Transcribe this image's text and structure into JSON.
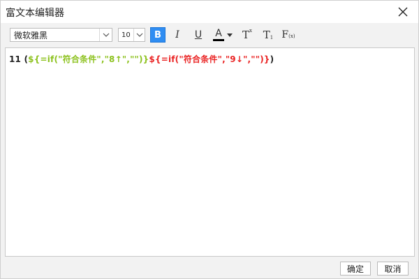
{
  "window": {
    "title": "富文本编辑器"
  },
  "toolbar": {
    "font_family": "微软雅黑",
    "font_size": "10",
    "bold_label": "B",
    "italic_label": "I",
    "underline_label": "U",
    "color_label": "A",
    "superscript_label": "T",
    "superscript_small": "x",
    "subscript_label": "T",
    "subscript_small": "1",
    "formula_label": "F",
    "formula_small": "(x)",
    "active_color": "#000000",
    "bold_active": true
  },
  "editor": {
    "prefix": "11  (",
    "green_segment": "${=if(\"符合条件\",\"8↑\",\"\")}",
    "red_segment": "${=if(\"符合条件\",\"9↓\",\"\")}",
    "suffix": ")",
    "colors": {
      "green": "#8dc21f",
      "red": "#ea2424"
    }
  },
  "footer": {
    "ok_label": "确定",
    "cancel_label": "取消"
  },
  "icons": {
    "close": "close-icon",
    "dropdown": "chevron-down-icon"
  }
}
